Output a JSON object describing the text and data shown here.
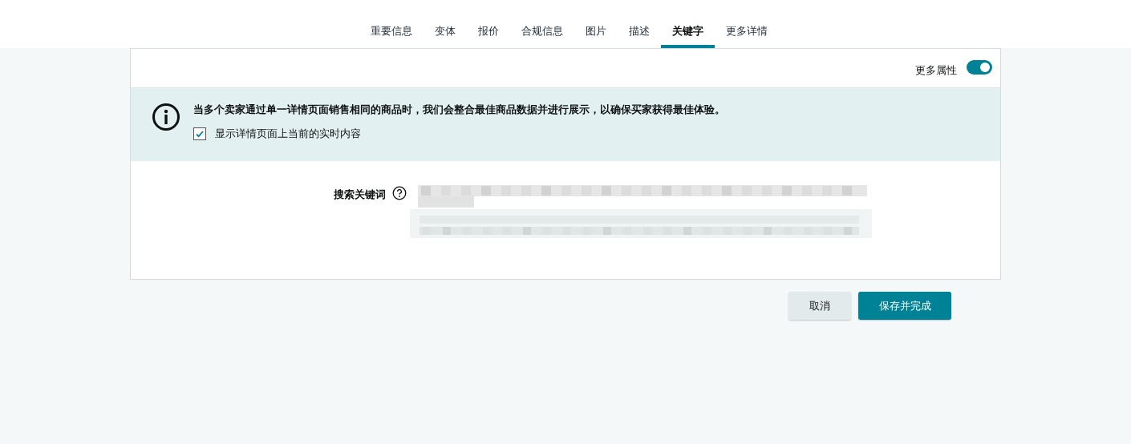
{
  "tabs": [
    {
      "label": "重要信息",
      "selected": false
    },
    {
      "label": "变体",
      "selected": false
    },
    {
      "label": "报价",
      "selected": false
    },
    {
      "label": "合规信息",
      "selected": false
    },
    {
      "label": "图片",
      "selected": false
    },
    {
      "label": "描述",
      "selected": false
    },
    {
      "label": "关键字",
      "selected": true
    },
    {
      "label": "更多详情",
      "selected": false
    }
  ],
  "more_attributes": {
    "label": "更多属性",
    "on": true
  },
  "notice": {
    "text": "当多个卖家通过单一详情页面销售相同的商品时，我们会整合最佳商品数据并进行展示，以确保买家获得最佳体验。",
    "checkbox": {
      "label": "显示详情页面上当前的实时内容",
      "checked": true
    }
  },
  "search_keywords": {
    "label": "搜索关键词"
  },
  "buttons": [
    {
      "label": "取消",
      "kind": "secondary"
    },
    {
      "label": "保存并完成",
      "kind": "primary"
    }
  ]
}
